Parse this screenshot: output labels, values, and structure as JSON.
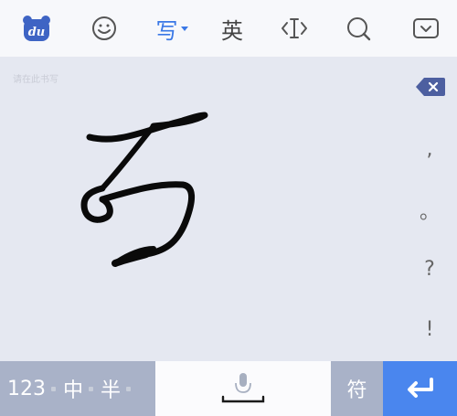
{
  "toolbar": {
    "logo_text": "du",
    "logo_icon": "bear-logo-icon",
    "emoji_icon": "smiley-icon",
    "write_label": "写",
    "english_label": "英",
    "cursor_icon": "text-cursor-icon",
    "search_icon": "search-icon",
    "hide_icon": "keyboard-hide-icon"
  },
  "pad": {
    "hint": "请在此书写"
  },
  "punctuation": [
    ",",
    "。",
    "?",
    "!"
  ],
  "bottom": {
    "numbers_label": "123",
    "chinese_label": "中",
    "half_label": "半",
    "symbols_label": "符",
    "mic_icon": "microphone-icon",
    "enter_icon": "enter-icon"
  },
  "colors": {
    "accent": "#3a78e6",
    "enter_key": "#4a86ee",
    "function_key": "#a9b2c8",
    "pad_bg": "#e5e8f1"
  }
}
